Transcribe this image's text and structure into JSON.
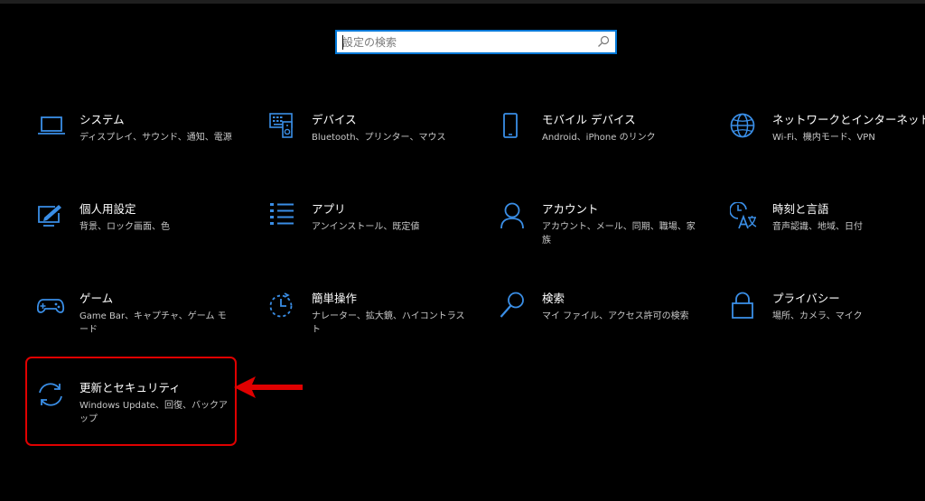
{
  "search": {
    "placeholder": "設定の検索",
    "value": ""
  },
  "tiles": [
    {
      "title": "システム",
      "desc": "ディスプレイ、サウンド、通知、電源",
      "icon": "laptop-icon"
    },
    {
      "title": "デバイス",
      "desc": "Bluetooth、プリンター、マウス",
      "icon": "devices-icon"
    },
    {
      "title": "モバイル デバイス",
      "desc": "Android、iPhone のリンク",
      "icon": "phone-icon"
    },
    {
      "title": "ネットワークとインターネット",
      "desc": "Wi-Fi、機内モード、VPN",
      "icon": "globe-icon"
    },
    {
      "title": "個人用設定",
      "desc": "背景、ロック画面、色",
      "icon": "personalization-icon"
    },
    {
      "title": "アプリ",
      "desc": "アンインストール、既定値",
      "icon": "apps-list-icon"
    },
    {
      "title": "アカウント",
      "desc": "アカウント、メール、同期、職場、家族",
      "icon": "person-icon"
    },
    {
      "title": "時刻と言語",
      "desc": "音声認識、地域、日付",
      "icon": "time-language-icon"
    },
    {
      "title": "ゲーム",
      "desc": "Game Bar、キャプチャ、ゲーム モード",
      "icon": "gamepad-icon"
    },
    {
      "title": "簡単操作",
      "desc": "ナレーター、拡大鏡、ハイコントラスト",
      "icon": "ease-of-access-icon"
    },
    {
      "title": "検索",
      "desc": "マイ ファイル、アクセス許可の検索",
      "icon": "magnifier-icon"
    },
    {
      "title": "プライバシー",
      "desc": "場所、カメラ、マイク",
      "icon": "lock-icon"
    },
    {
      "title": "更新とセキュリティ",
      "desc": "Windows Update、回復、バックアップ",
      "icon": "sync-icon"
    }
  ],
  "colors": {
    "accent": "#0078d7",
    "icon": "#3a8ee6",
    "annotation": "#e00000",
    "background": "#000000"
  }
}
